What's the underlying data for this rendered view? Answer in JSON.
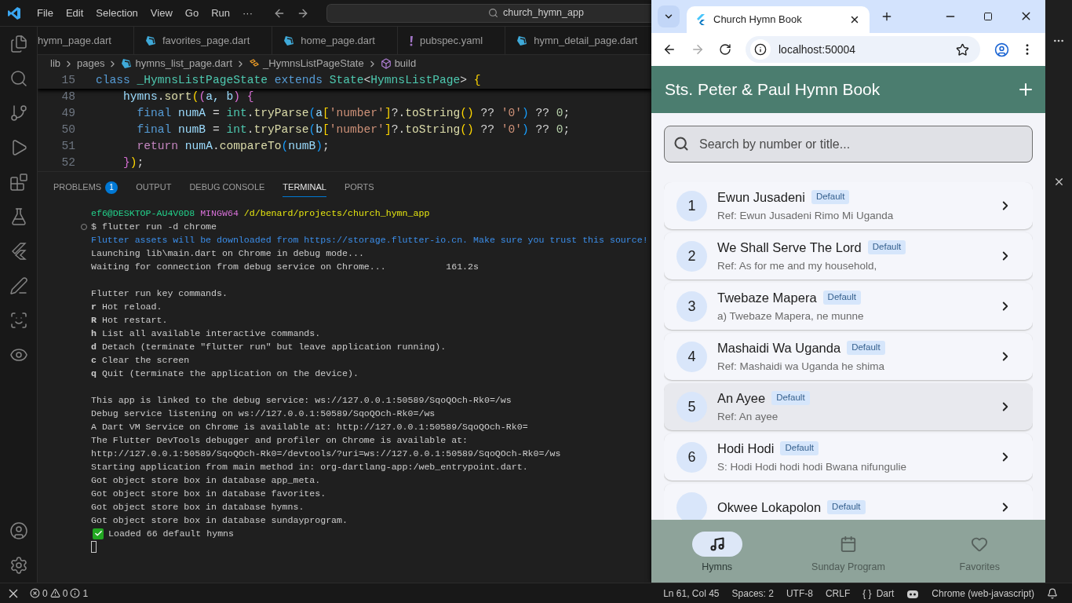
{
  "vscode": {
    "menu": [
      "File",
      "Edit",
      "Selection",
      "View",
      "Go",
      "Run",
      "···"
    ],
    "command_center": "church_hymn_app",
    "editor_tabs": [
      {
        "label": "hymn_page.dart",
        "kind": "none"
      },
      {
        "label": "favorites_page.dart",
        "kind": "dart"
      },
      {
        "label": "home_page.dart",
        "kind": "dart"
      },
      {
        "label": "pubspec.yaml",
        "kind": "yaml"
      },
      {
        "label": "hymn_detail_page.dart",
        "kind": "dart"
      }
    ],
    "breadcrumb": [
      {
        "label": "lib",
        "kind": "folder"
      },
      {
        "label": "pages",
        "kind": "folder"
      },
      {
        "label": "hymns_list_page.dart",
        "kind": "dart"
      },
      {
        "label": "_HymnsListPageState",
        "kind": "class"
      },
      {
        "label": "build",
        "kind": "method"
      }
    ],
    "sticky_line": {
      "number": "15",
      "tokens": [
        {
          "text": "class ",
          "kind": "keyword"
        },
        {
          "text": "_HymnsListPageState",
          "kind": "type"
        },
        {
          "text": " extends ",
          "kind": "keyword"
        },
        {
          "text": "State",
          "kind": "type"
        },
        {
          "text": "<",
          "kind": "plain"
        },
        {
          "text": "HymnsListPage",
          "kind": "type"
        },
        {
          "text": ">",
          "kind": "plain"
        },
        {
          "text": " {",
          "kind": "bracket1"
        }
      ]
    },
    "code_lines": [
      {
        "number": "48",
        "tokens": [
          {
            "text": "    hymns",
            "kind": "variable"
          },
          {
            "text": ".",
            "kind": "plain"
          },
          {
            "text": "sort",
            "kind": "function"
          },
          {
            "text": "(",
            "kind": "bracket1"
          },
          {
            "text": "(",
            "kind": "bracket2"
          },
          {
            "text": "a, b",
            "kind": "variable"
          },
          {
            "text": ")",
            "kind": "bracket2"
          },
          {
            "text": " {",
            "kind": "bracket2"
          }
        ]
      },
      {
        "number": "49",
        "tokens": [
          {
            "text": "      final ",
            "kind": "keyword"
          },
          {
            "text": "numA",
            "kind": "variable"
          },
          {
            "text": " = ",
            "kind": "plain"
          },
          {
            "text": "int",
            "kind": "type"
          },
          {
            "text": ".",
            "kind": "plain"
          },
          {
            "text": "tryParse",
            "kind": "function"
          },
          {
            "text": "(",
            "kind": "bracket3"
          },
          {
            "text": "a",
            "kind": "variable"
          },
          {
            "text": "[",
            "kind": "bracket1"
          },
          {
            "text": "'number'",
            "kind": "string"
          },
          {
            "text": "]",
            "kind": "bracket1"
          },
          {
            "text": "?.",
            "kind": "plain"
          },
          {
            "text": "toString",
            "kind": "function"
          },
          {
            "text": "()",
            "kind": "bracket1"
          },
          {
            "text": " ?? ",
            "kind": "plain"
          },
          {
            "text": "'0'",
            "kind": "string"
          },
          {
            "text": ")",
            "kind": "bracket3"
          },
          {
            "text": " ?? ",
            "kind": "plain"
          },
          {
            "text": "0",
            "kind": "number"
          },
          {
            "text": ";",
            "kind": "plain"
          }
        ]
      },
      {
        "number": "50",
        "tokens": [
          {
            "text": "      final ",
            "kind": "keyword"
          },
          {
            "text": "numB",
            "kind": "variable"
          },
          {
            "text": " = ",
            "kind": "plain"
          },
          {
            "text": "int",
            "kind": "type"
          },
          {
            "text": ".",
            "kind": "plain"
          },
          {
            "text": "tryParse",
            "kind": "function"
          },
          {
            "text": "(",
            "kind": "bracket3"
          },
          {
            "text": "b",
            "kind": "variable"
          },
          {
            "text": "[",
            "kind": "bracket1"
          },
          {
            "text": "'number'",
            "kind": "string"
          },
          {
            "text": "]",
            "kind": "bracket1"
          },
          {
            "text": "?.",
            "kind": "plain"
          },
          {
            "text": "toString",
            "kind": "function"
          },
          {
            "text": "()",
            "kind": "bracket1"
          },
          {
            "text": " ?? ",
            "kind": "plain"
          },
          {
            "text": "'0'",
            "kind": "string"
          },
          {
            "text": ")",
            "kind": "bracket3"
          },
          {
            "text": " ?? ",
            "kind": "plain"
          },
          {
            "text": "0",
            "kind": "number"
          },
          {
            "text": ";",
            "kind": "plain"
          }
        ]
      },
      {
        "number": "51",
        "tokens": [
          {
            "text": "      return ",
            "kind": "control"
          },
          {
            "text": "numA",
            "kind": "variable"
          },
          {
            "text": ".",
            "kind": "plain"
          },
          {
            "text": "compareTo",
            "kind": "function"
          },
          {
            "text": "(",
            "kind": "bracket3"
          },
          {
            "text": "numB",
            "kind": "variable"
          },
          {
            "text": ")",
            "kind": "bracket3"
          },
          {
            "text": ";",
            "kind": "plain"
          }
        ]
      },
      {
        "number": "52",
        "tokens": [
          {
            "text": "    }",
            "kind": "bracket2"
          },
          {
            "text": ")",
            "kind": "bracket1"
          },
          {
            "text": ";",
            "kind": "plain"
          }
        ]
      }
    ],
    "panel_tabs": [
      {
        "label": "PROBLEMS",
        "badge": "1",
        "selected": false
      },
      {
        "label": "OUTPUT",
        "selected": false
      },
      {
        "label": "DEBUG CONSOLE",
        "selected": false
      },
      {
        "label": "TERMINAL",
        "selected": true
      },
      {
        "label": "PORTS",
        "selected": false
      }
    ],
    "terminal_lines": [
      {
        "kind": "prompt",
        "user": "ef6@DESKTOP-AU4V0D8",
        "shell": "MINGW64",
        "path": "/d/benard/projects/church_hymn_app"
      },
      {
        "kind": "command",
        "text": "$ flutter run -d chrome"
      },
      {
        "kind": "info",
        "text": "Flutter assets will be downloaded from https://storage.flutter-io.cn. Make sure you trust this source!"
      },
      {
        "kind": "text",
        "text": "Launching lib\\main.dart on Chrome in debug mode..."
      },
      {
        "kind": "text",
        "text": "Waiting for connection from debug service on Chrome...           161.2s"
      },
      {
        "kind": "blank"
      },
      {
        "kind": "text",
        "text": "Flutter run key commands."
      },
      {
        "kind": "text",
        "text": "**r** Hot reload."
      },
      {
        "kind": "text",
        "text": "**R** Hot restart."
      },
      {
        "kind": "text",
        "text": "**h** List all available interactive commands."
      },
      {
        "kind": "text",
        "text": "**d** Detach (terminate \"flutter run\" but leave application running)."
      },
      {
        "kind": "text",
        "text": "**c** Clear the screen"
      },
      {
        "kind": "text",
        "text": "**q** Quit (terminate the application on the device)."
      },
      {
        "kind": "blank"
      },
      {
        "kind": "text",
        "text": "This app is linked to the debug service: ws://127.0.0.1:50589/SqoQOch-Rk0=/ws"
      },
      {
        "kind": "text",
        "text": "Debug service listening on ws://127.0.0.1:50589/SqoQOch-Rk0=/ws"
      },
      {
        "kind": "text",
        "text": "A Dart VM Service on Chrome is available at: http://127.0.0.1:50589/SqoQOch-Rk0="
      },
      {
        "kind": "text",
        "text": "The Flutter DevTools debugger and profiler on Chrome is available at:"
      },
      {
        "kind": "text",
        "text": "http://127.0.0.1:50589/SqoQOch-Rk0=/devtools/?uri=ws://127.0.0.1:50589/SqoQOch-Rk0=/ws"
      },
      {
        "kind": "text",
        "text": "Starting application from main method in: org-dartlang-app:/web_entrypoint.dart."
      },
      {
        "kind": "text",
        "text": "Got object store box in database app_meta."
      },
      {
        "kind": "text",
        "text": "Got object store box in database favorites."
      },
      {
        "kind": "text",
        "text": "Got object store box in database hymns."
      },
      {
        "kind": "text",
        "text": "Got object store box in database sundayprogram."
      },
      {
        "kind": "success",
        "text": "Loaded 66 default hymns"
      },
      {
        "kind": "cursor"
      }
    ],
    "status_bar": {
      "errors": "0",
      "warnings": "0",
      "infos": "1",
      "right": [
        {
          "label": "Ln 61, Col 45",
          "kind": "text"
        },
        {
          "label": "Spaces: 2",
          "kind": "text"
        },
        {
          "label": "UTF-8",
          "kind": "text"
        },
        {
          "label": "CRLF",
          "kind": "text"
        },
        {
          "label": "Dart",
          "braces": "{ }",
          "kind": "language"
        },
        {
          "kind": "copilot"
        },
        {
          "label": "Chrome (web-javascript)",
          "kind": "text"
        },
        {
          "kind": "bell"
        }
      ]
    }
  },
  "browser": {
    "tab_title": "Church Hymn Book",
    "address": "localhost:50004",
    "forward_enabled": false,
    "app": {
      "title": "Sts. Peter & Paul Hymn Book",
      "search": {
        "placeholder": "Search by number or title..."
      },
      "hymns": [
        {
          "number": "1",
          "title": "Ewun Jusadeni",
          "tag": "Default",
          "subtitle": "Ref: Ewun Jusadeni Rimo Mi Uganda",
          "highlighted": false
        },
        {
          "number": "2",
          "title": "We Shall Serve The Lord",
          "tag": "Default",
          "subtitle": "Ref: As for me and my household,",
          "highlighted": false
        },
        {
          "number": "3",
          "title": "Twebaze Mapera",
          "tag": "Default",
          "subtitle": "a) Twebaze Mapera, ne munne",
          "highlighted": false
        },
        {
          "number": "4",
          "title": "Mashaidi Wa Uganda",
          "tag": "Default",
          "subtitle": "Ref: Mashaidi wa Uganda he shima",
          "highlighted": false
        },
        {
          "number": "5",
          "title": "An Ayee",
          "tag": "Default",
          "subtitle": "Ref: An ayee",
          "highlighted": true
        },
        {
          "number": "6",
          "title": "Hodi Hodi",
          "tag": "Default",
          "subtitle": "S: Hodi Hodi hodi hodi Bwana nifungulie",
          "highlighted": false
        },
        {
          "title": "Okwee Lokapolon",
          "tag": "Default",
          "highlighted": false
        }
      ],
      "nav": [
        {
          "label": "Hymns",
          "kind": "hymns",
          "selected": true
        },
        {
          "label": "Sunday Program",
          "kind": "calendar",
          "selected": false
        },
        {
          "label": "Favorites",
          "kind": "heart",
          "selected": false
        }
      ]
    }
  }
}
